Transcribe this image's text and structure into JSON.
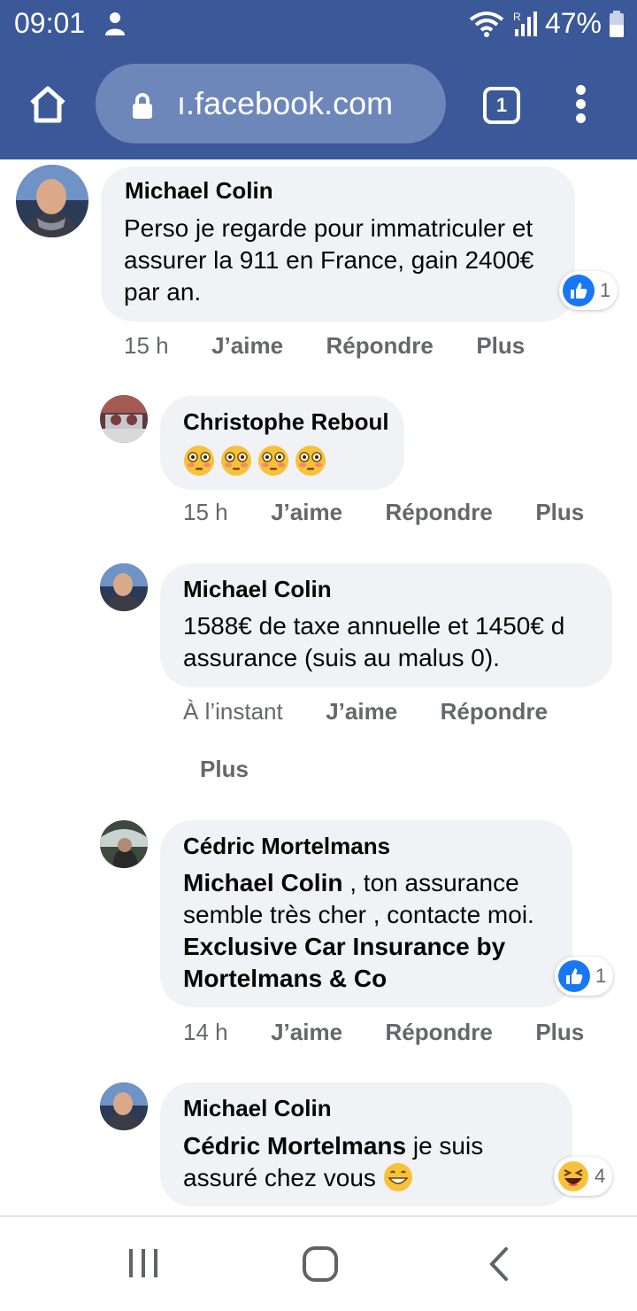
{
  "status_bar": {
    "time": "09:01",
    "battery": "47%"
  },
  "browser": {
    "url": "ı.facebook.com",
    "tab_count": "1"
  },
  "comments": [
    {
      "author": "Michael Colin",
      "text": "Perso je regarde pour immatriculer et assurer la 911 en France, gain 2400€ par an.",
      "time": "15 h",
      "reaction_count": "1"
    },
    {
      "author": "Christophe Reboul",
      "time": "15 h"
    },
    {
      "author": "Michael Colin",
      "text": "1588€ de taxe annuelle et 1450€ d assurance (suis au malus 0).",
      "time": "À l’instant"
    },
    {
      "author": "Cédric Mortelmans",
      "mention": "Michael Colin",
      "text_1": " , ton assurance semble très cher , contacte moi. ",
      "bold_2": "Exclusive Car Insurance by Mortelmans & Co",
      "time": "14 h",
      "reaction_count": "1"
    },
    {
      "author": "Michael Colin",
      "mention": "Cédric Mortelmans",
      "text_1": " je suis assuré chez vous ",
      "reaction_count": "4"
    }
  ],
  "actions": {
    "like": "J’aime",
    "reply": "Répondre",
    "more": "Plus"
  },
  "icons": {
    "home": "home-icon",
    "lock": "lock-icon",
    "menu": "more-vert-icon",
    "like": "thumbs-up-icon",
    "haha": "laughing-emoji-icon",
    "nav_recents": "recents-icon",
    "nav_home": "nav-home-icon",
    "nav_back": "back-icon"
  },
  "colors": {
    "browser_bar": "#3b5998",
    "url_pill": "#6d87bb",
    "bubble": "#f0f2f5",
    "like_blue": "#1877f2",
    "secondary_text": "#65676b"
  }
}
